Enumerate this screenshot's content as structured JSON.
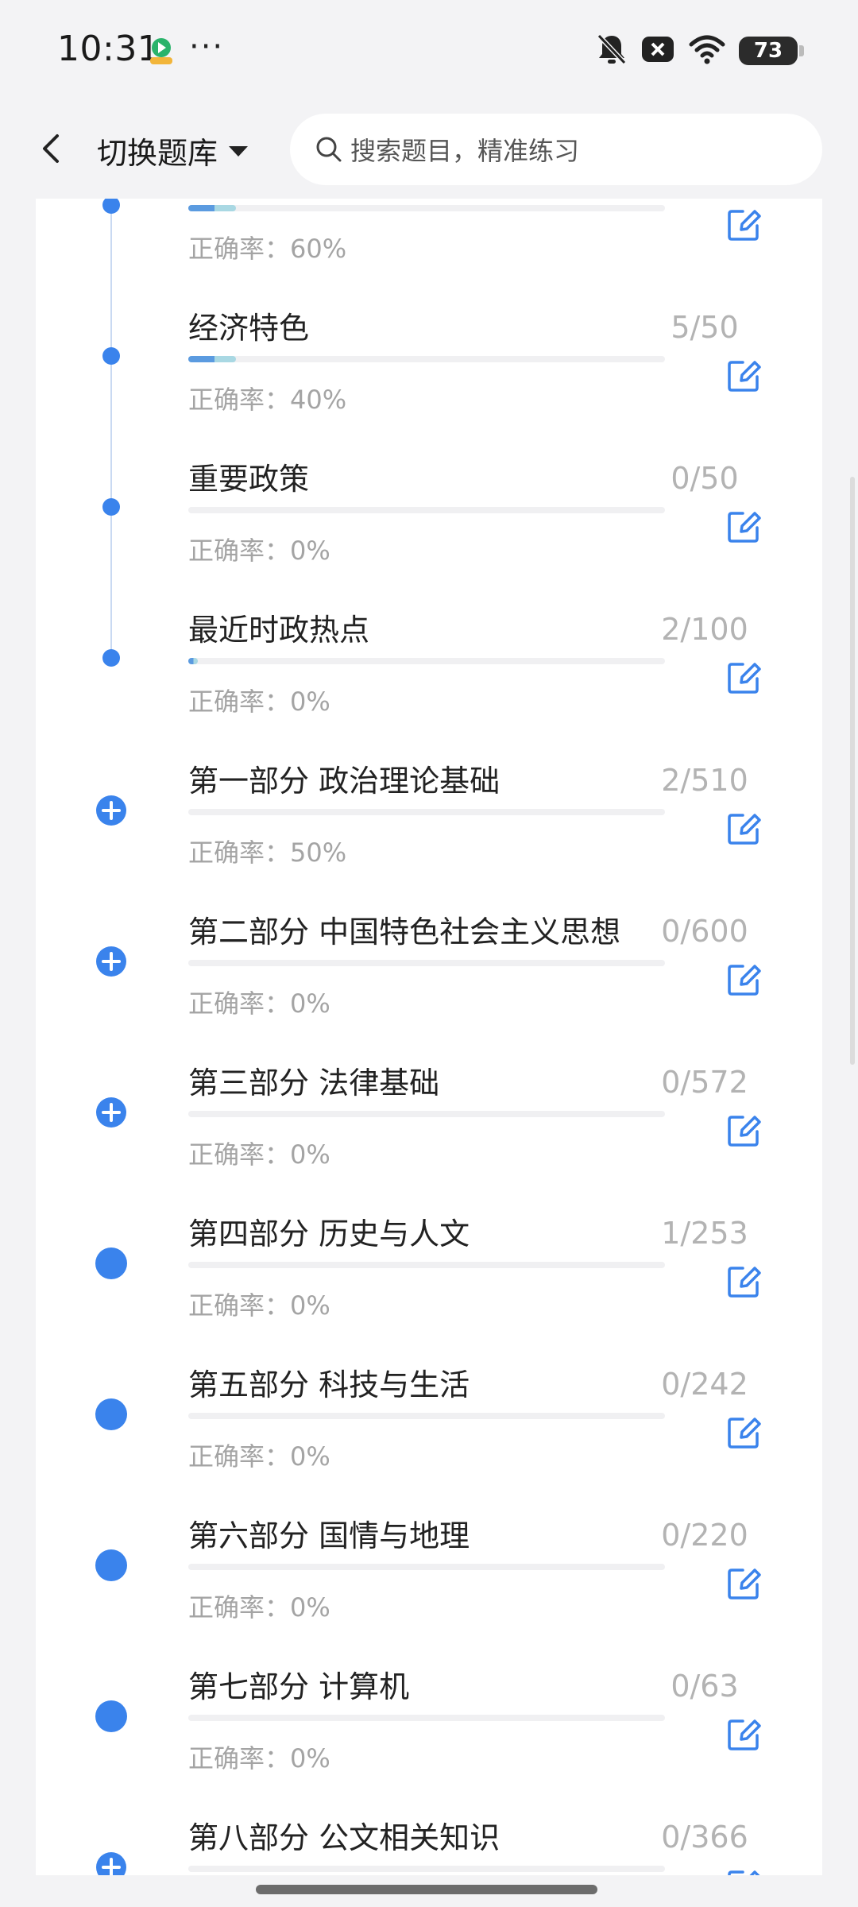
{
  "status_bar": {
    "time": "10:31",
    "more": "···",
    "battery": "73",
    "icons": [
      "bell-off-icon",
      "notification-close-icon",
      "wifi-icon",
      "battery-icon"
    ]
  },
  "header": {
    "back_icon": "chevron-left-icon",
    "title": "切换题库",
    "dropdown_icon": "caret-down-icon",
    "search_placeholder": "搜索题目，精准练习"
  },
  "colors": {
    "accent": "#3a83ec",
    "progress_main": "#5b9be0",
    "progress_light": "#a9d8e3",
    "muted_text": "#a4a4a4"
  },
  "items": [
    {
      "title": "",
      "accuracy": "正确率：60%",
      "count": "",
      "progress": 0.1,
      "marker": "timeline-dot"
    },
    {
      "title": "经济特色",
      "accuracy": "正确率：40%",
      "count": "5/50",
      "progress": 0.1,
      "marker": "timeline-dot"
    },
    {
      "title": "重要政策",
      "accuracy": "正确率：0%",
      "count": "0/50",
      "progress": 0,
      "marker": "timeline-dot"
    },
    {
      "title": "最近时政热点",
      "accuracy": "正确率：0%",
      "count": "2/100",
      "progress": 0.02,
      "marker": "timeline-dot"
    },
    {
      "title": "第一部分 政治理论基础",
      "accuracy": "正确率：50%",
      "count": "2/510",
      "progress": 0,
      "marker": "expand-plus"
    },
    {
      "title": "第二部分 中国特色社会主义思想",
      "accuracy": "正确率：0%",
      "count": "0/600",
      "progress": 0,
      "marker": "expand-plus"
    },
    {
      "title": "第三部分 法律基础",
      "accuracy": "正确率：0%",
      "count": "0/572",
      "progress": 0,
      "marker": "expand-plus"
    },
    {
      "title": "第四部分 历史与人文",
      "accuracy": "正确率：0%",
      "count": "1/253",
      "progress": 0,
      "marker": "dot"
    },
    {
      "title": "第五部分 科技与生活",
      "accuracy": "正确率：0%",
      "count": "0/242",
      "progress": 0,
      "marker": "dot"
    },
    {
      "title": "第六部分 国情与地理",
      "accuracy": "正确率：0%",
      "count": "0/220",
      "progress": 0,
      "marker": "dot"
    },
    {
      "title": "第七部分 计算机",
      "accuracy": "正确率：0%",
      "count": "0/63",
      "progress": 0,
      "marker": "dot"
    },
    {
      "title": "第八部分 公文相关知识",
      "accuracy": "",
      "count": "0/366",
      "progress": 0,
      "marker": "expand-plus"
    }
  ]
}
